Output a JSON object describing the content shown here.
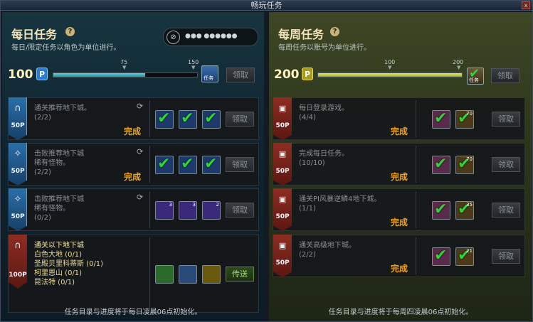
{
  "window": {
    "title": "畅玩任务",
    "close": "x"
  },
  "daily": {
    "title": "每日任务",
    "help": "?",
    "subtitle": "每日/限定任务以角色为单位进行。",
    "password": "●●● ●●●●●●",
    "points": "100",
    "points_badge": "P",
    "marks": [
      "75",
      "150"
    ],
    "progress": 0.64,
    "chest_label": "任务",
    "claim": "领取",
    "quests": [
      {
        "title": "通关推荐地下城。",
        "lines": [
          "(2/2)"
        ],
        "points": "50P",
        "status": "完成",
        "banner": "blue",
        "icon": "∩",
        "active": false,
        "btn": "领取",
        "rewards": [
          {
            "icon": "check-icon",
            "checked": true
          },
          {
            "icon": "check-icon",
            "checked": true
          },
          {
            "icon": "check-icon",
            "checked": true
          }
        ]
      },
      {
        "title": "击败推荐地下城",
        "lines": [
          "稀有怪物。",
          "(2/2)"
        ],
        "points": "50P",
        "status": "完成",
        "banner": "blue",
        "icon": "✧",
        "active": false,
        "btn": "领取",
        "rewards": [
          {
            "icon": "check-icon",
            "checked": true
          },
          {
            "icon": "check-icon",
            "checked": true
          },
          {
            "icon": "check-icon",
            "checked": true
          }
        ]
      },
      {
        "title": "击败推荐地下城",
        "lines": [
          "稀有怪物。",
          "(0/2)"
        ],
        "points": "50P",
        "status": "",
        "banner": "blue",
        "icon": "✧",
        "active": false,
        "btn": "领取",
        "rewards": [
          {
            "icon": "potion-icon",
            "checked": false,
            "count": "3"
          },
          {
            "icon": "potion-icon",
            "checked": false,
            "count": "3"
          },
          {
            "icon": "scroll-icon",
            "checked": false,
            "count": "2"
          }
        ]
      },
      {
        "title": "通关以下地下城",
        "lines": [
          "白色大地 (0/1)",
          "圣殿贝里科蒂斯 (0/1)",
          "柯里恩山 (0/1)",
          "昆法特 (0/1)"
        ],
        "points": "100P",
        "status": "",
        "banner": "red",
        "icon": "∩",
        "active": true,
        "btn": "传送",
        "rewards": [
          {
            "icon": "bottle-icon",
            "checked": false
          },
          {
            "icon": "crystal-icon",
            "checked": false
          },
          {
            "icon": "box-icon",
            "checked": false
          }
        ]
      }
    ],
    "footer": "任务目录与进度将于每日凌晨06点初始化。"
  },
  "weekly": {
    "title": "每周任务",
    "help": "?",
    "subtitle": "每周任务以账号为单位进行。",
    "points": "200",
    "points_badge": "P",
    "marks": [
      "100",
      "200"
    ],
    "progress": 1.0,
    "chest_label": "任务",
    "claim": "领取",
    "quests": [
      {
        "title": "每日登录游戏。",
        "lines": [
          "(4/4)"
        ],
        "points": "50P",
        "status": "完成",
        "btn": "领取",
        "rewards": [
          {
            "icon": "check-icon",
            "checked": true
          },
          {
            "icon": "check-icon",
            "checked": true,
            "count": "70"
          }
        ]
      },
      {
        "title": "完成每日任务。",
        "lines": [
          "(10/10)"
        ],
        "points": "50P",
        "status": "完成",
        "btn": "领取",
        "rewards": [
          {
            "icon": "check-icon",
            "checked": true
          },
          {
            "icon": "check-icon",
            "checked": true,
            "count": "70"
          }
        ]
      },
      {
        "title": "通关PI风暴逆鳞4地下城。",
        "lines": [
          "(1/1)"
        ],
        "points": "50P",
        "status": "完成",
        "btn": "领取",
        "rewards": [
          {
            "icon": "check-icon",
            "checked": true
          },
          {
            "icon": "check-icon",
            "checked": true,
            "count": "35"
          }
        ]
      },
      {
        "title": "通关高级地下城。",
        "lines": [
          "(2/2)"
        ],
        "points": "50P",
        "status": "完成",
        "btn": "领取",
        "rewards": [
          {
            "icon": "check-icon",
            "checked": true
          },
          {
            "icon": "check-icon",
            "checked": true,
            "count": "21"
          }
        ]
      }
    ],
    "footer": "任务目录与进度将于每周四凌晨06点初始化。"
  }
}
